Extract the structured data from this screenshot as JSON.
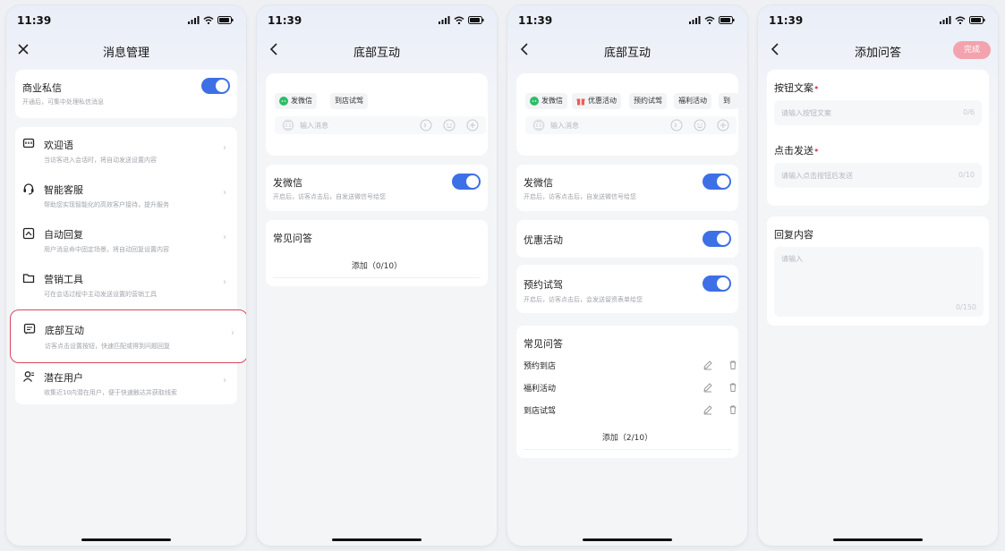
{
  "status": {
    "time": "11:39"
  },
  "screen1": {
    "title": "消息管理",
    "biz": {
      "title": "商业私信",
      "desc": "开通后，可集中处理私信消息"
    },
    "menu": [
      {
        "title": "欢迎语",
        "desc": "当访客进入会话时，将自动发送设置内容"
      },
      {
        "title": "智能客服",
        "desc": "帮助您实现智能化的高效客户接待，提升服务"
      },
      {
        "title": "自动回复",
        "desc": "用户消息命中固定场景，将自动回复设置内容"
      },
      {
        "title": "营销工具",
        "desc": "可在会话过程中主动发送设置的营销工具"
      },
      {
        "title": "底部互动",
        "desc": "访客点击设置按钮，快速匹配或得到问题回复"
      },
      {
        "title": "潜在用户",
        "desc": "收集近10内潜在用户，便于快速触达并获取线索"
      }
    ]
  },
  "screen2": {
    "title": "底部互动",
    "chips": [
      "发微信",
      "到店试驾"
    ],
    "input_placeholder": "输入消息",
    "wechat": {
      "title": "发微信",
      "desc": "开启后，访客点击后，自发送微信号给您"
    },
    "faq_title": "常见问答",
    "add_label": "添加（0/10）"
  },
  "screen3": {
    "title": "底部互动",
    "chips": [
      "发微信",
      "优惠活动",
      "预约试驾",
      "福利活动",
      "到"
    ],
    "input_placeholder": "输入消息",
    "wechat": {
      "title": "发微信",
      "desc": "开启后，访客点击后，自发送微信号给您"
    },
    "promo": {
      "title": "优惠活动"
    },
    "testdrive": {
      "title": "预约试驾",
      "desc": "开启后，访客点击后，会发送留资表单给您"
    },
    "faq_title": "常见问答",
    "faq_items": [
      "预约到店",
      "福利活动",
      "到店试驾"
    ],
    "add_label": "添加（2/10）"
  },
  "screen4": {
    "title": "添加问答",
    "save_label": "完成",
    "btn_text": {
      "label": "按钮文案",
      "required": "•",
      "placeholder": "请输入按钮文案",
      "count": "0/6"
    },
    "click_send": {
      "label": "点击发送",
      "required": "•",
      "placeholder": "请输入点击按钮后发送",
      "count": "0/10"
    },
    "reply": {
      "label": "回复内容",
      "placeholder": "请输入",
      "count": "0/150"
    }
  },
  "colors": {
    "accent": "#3d6fe6",
    "highlight": "#d9475e",
    "wechat_green": "#2bbd69",
    "promo_red": "#ef5b5b"
  }
}
